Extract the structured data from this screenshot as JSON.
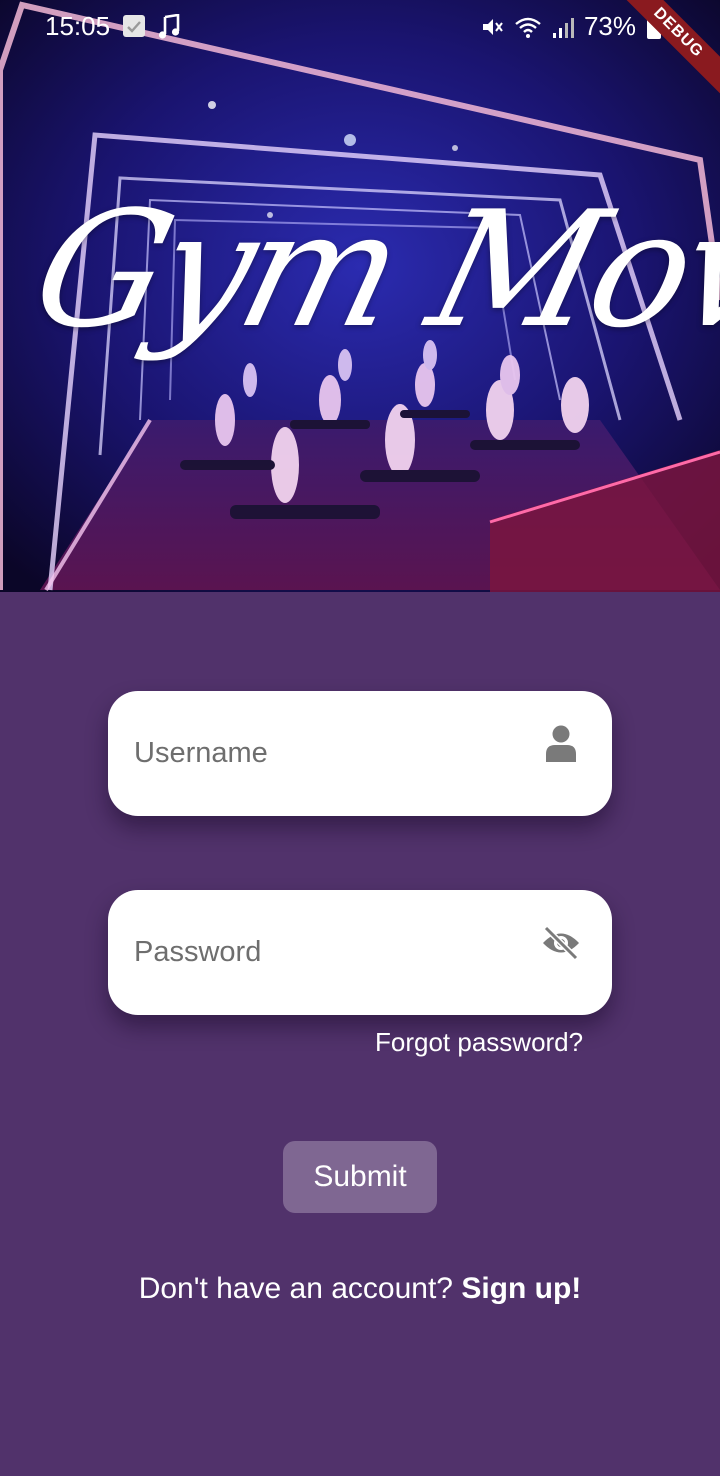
{
  "status_bar": {
    "time": "15:05",
    "battery": "73%",
    "icons": [
      "gallery-notification-icon",
      "music-note-icon",
      "mute-icon",
      "wifi-icon",
      "signal-icon",
      "battery-icon"
    ]
  },
  "debug_banner": "DEBUG",
  "hero": {
    "title": "Gym Moves"
  },
  "form": {
    "username": {
      "placeholder": "Username",
      "value": "",
      "icon": "person-icon"
    },
    "password": {
      "placeholder": "Password",
      "value": "",
      "icon": "eye-off-icon"
    },
    "forgot_label": "Forgot password?",
    "submit_label": "Submit"
  },
  "signup": {
    "prompt": "Don't have an account?",
    "link_label": "Sign up!"
  },
  "colors": {
    "background": "#51326b",
    "submit_button": "#7f6792",
    "field": "#ffffff",
    "icon_gray": "#7a7a7a"
  }
}
